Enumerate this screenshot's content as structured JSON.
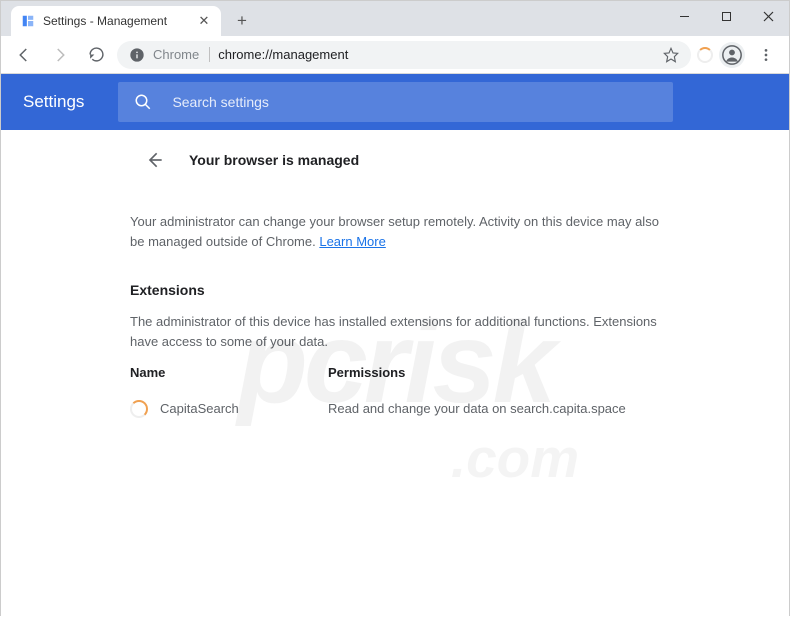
{
  "tab": {
    "title": "Settings - Management"
  },
  "omnibox": {
    "scheme": "Chrome",
    "url": "chrome://management"
  },
  "settings": {
    "title": "Settings",
    "search_placeholder": "Search settings",
    "page_title": "Your browser is managed"
  },
  "management": {
    "admin_desc": "Your administrator can change your browser setup remotely. Activity on this device may also be managed outside of Chrome. ",
    "learn_more": "Learn More",
    "extensions_heading": "Extensions",
    "extensions_desc": "The administrator of this device has installed extensions for additional functions. Extensions have access to some of your data.",
    "col_name": "Name",
    "col_perm": "Permissions",
    "rows": [
      {
        "name": "CapitaSearch",
        "perm": "Read and change your data on search.capita.space"
      }
    ]
  },
  "watermark": {
    "main": "pcrisk",
    "sub": ".com"
  }
}
